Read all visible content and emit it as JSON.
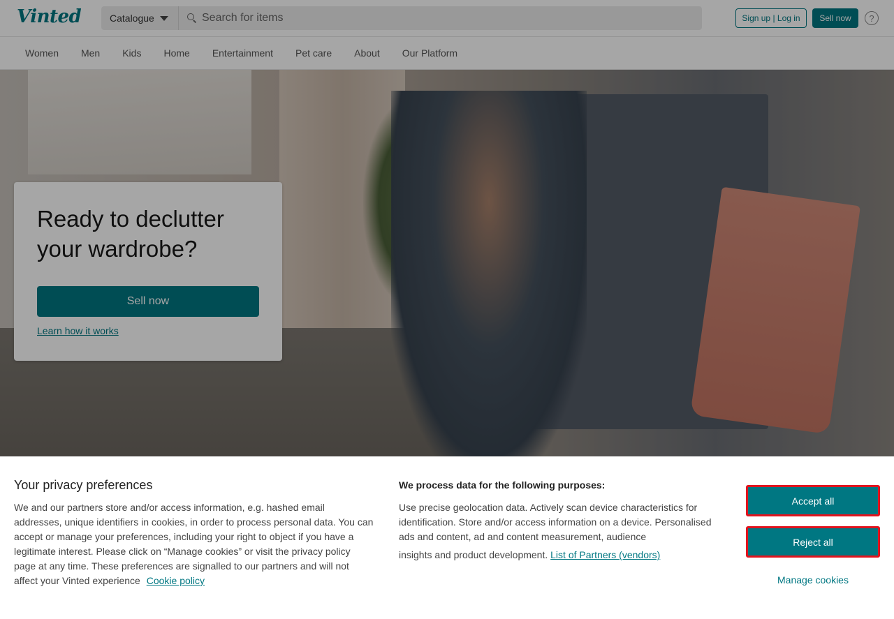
{
  "header": {
    "logo": "Vinted",
    "catalogue_label": "Catalogue",
    "search_placeholder": "Search for items",
    "signup_label": "Sign up | Log in",
    "sell_now_label": "Sell now",
    "help_glyph": "?"
  },
  "nav": {
    "items": [
      "Women",
      "Men",
      "Kids",
      "Home",
      "Entertainment",
      "Pet care",
      "About",
      "Our Platform"
    ]
  },
  "hero": {
    "title": "Ready to declutter your wardrobe?",
    "sell_button": "Sell now",
    "learn_link": "Learn how it works"
  },
  "cookie_banner": {
    "title": "Your privacy preferences",
    "body": "We and our partners store and/or access information, e.g. hashed email addresses, unique identifiers in cookies, in order to process personal data. You can accept or manage your preferences, including your right to object if you have a legitimate interest. Please click on “Manage cookies” or visit the privacy policy page at any time. These preferences are signalled to our partners and will not affect your Vinted experience",
    "cookie_policy_link": "Cookie policy",
    "purposes_title": "We process data for the following purposes:",
    "purposes_body": "Use precise geolocation data. Actively scan device characteristics for identification. Store and/or access information on a device. Personalised ads and content, ad and content measurement, audience",
    "purposes_last_line": "insights and product development.",
    "partners_link": "List of Partners (vendors)",
    "accept_all": "Accept all",
    "reject_all": "Reject all",
    "manage_cookies": "Manage cookies"
  },
  "colors": {
    "brand": "#007782",
    "highlight_border": "#e0141e"
  }
}
